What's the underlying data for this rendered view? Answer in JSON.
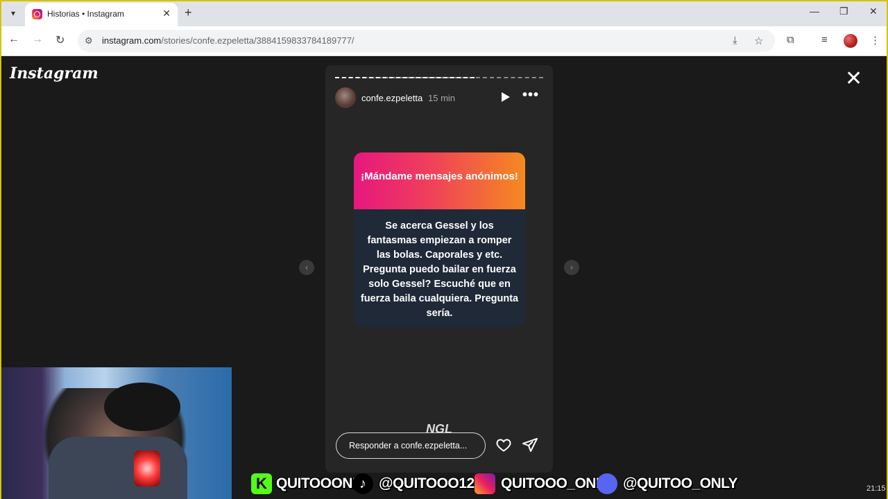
{
  "browser": {
    "tab_title": "Historias • Instagram",
    "url_host": "instagram.com",
    "url_path": "/stories/confe.ezpeletta/3884159833784189777/"
  },
  "instagram": {
    "logo": "Instagram",
    "story": {
      "username": "confe.ezpeletta",
      "time": "15 min",
      "progress": 0.67,
      "card_title": "¡Mándame mensajes anónimos!",
      "card_body": "Se acerca Gessel y los fantasmas empiezan a romper las bolas. Caporales y etc. Pregunta puedo bailar en fuerza solo Gessel? Escuché que en fuerza baila cualquiera. Pregunta sería.",
      "ngl_label": "NGL",
      "reply_placeholder": "Responder a confe.ezpeletta..."
    }
  },
  "overlay": {
    "kick": "QUITOOONLY",
    "tiktok": "@QUITOOO120",
    "instagram": "QUITOOO_ONLY",
    "discord": "@QUITOO_ONLY",
    "clock": "21:15"
  },
  "colors": {
    "card_gradient_start": "#e6177e",
    "card_gradient_end": "#f58a1f",
    "card_body_bg": "#1f2937",
    "frame_border": "#d8c200"
  },
  "icons": [
    "search-icon",
    "play-icon",
    "more-icon",
    "close-icon",
    "heart-icon",
    "send-icon"
  ]
}
